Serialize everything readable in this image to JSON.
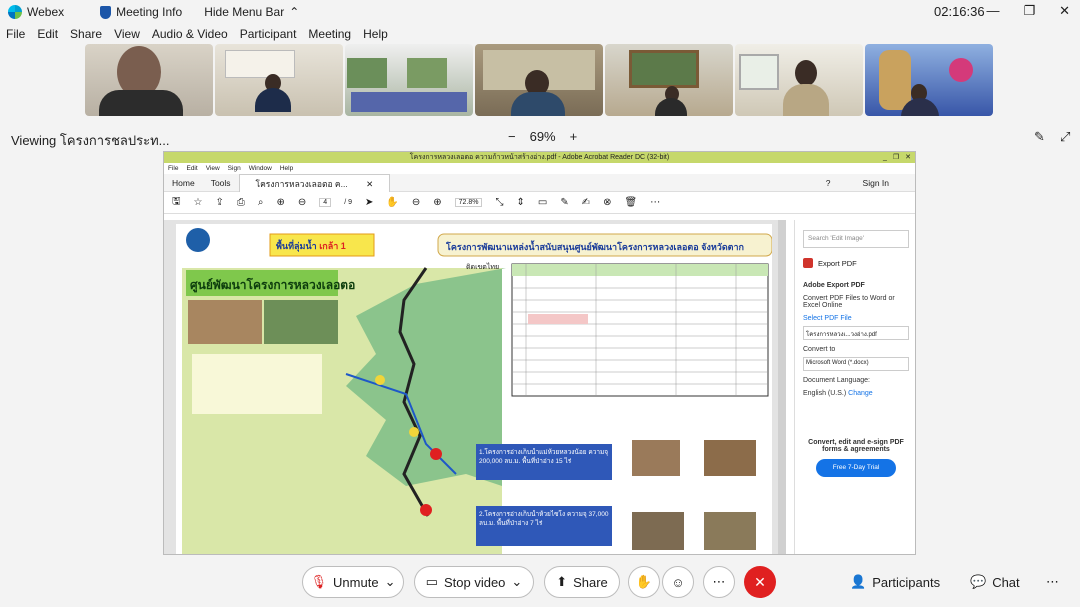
{
  "titlebar": {
    "app": "Webex",
    "meeting_info": "Meeting Info",
    "hide_menu": "Hide Menu Bar",
    "time": "02:16:36"
  },
  "menu": [
    "File",
    "Edit",
    "Share",
    "View",
    "Audio & Video",
    "Participant",
    "Meeting",
    "Help"
  ],
  "viewing": "Viewing โครงการชลประท...",
  "zoom": "69%",
  "acrobat": {
    "title": "โครงการหลวงเลอตอ ความก้าวหน้าสร้างอ่าง.pdf - Adobe Acrobat Reader DC (32-bit)",
    "menu": [
      "File",
      "Edit",
      "View",
      "Sign",
      "Window",
      "Help"
    ],
    "tabs": [
      "Home",
      "Tools",
      "โครงการหลวงเลอตอ ค..."
    ],
    "sign_in": "Sign In",
    "page": "4",
    "pages": "/ 9",
    "zoompct": "72.8%"
  },
  "doc": {
    "heading_left": "พื้นที่ลุ่มน้ำ",
    "heading_left2": "เกล้า 1",
    "heading_right": "โครงการพัฒนาแหล่งน้ำสนับสนุนศูนย์พัฒนาโครงการหลวงเลอตอ จังหวัดตาก",
    "center_name": "ศูนย์พัฒนาโครงการหลวงเลอตอ",
    "callouts": [
      "1.โครงการอ่างเก็บน้ำแม่ห้วยหลวงน้อย ความจุ 200,000 ลบ.ม. พื้นที่ป่าอ่าง 15 ไร่",
      "2.โครงการอ่างเก็บน้ำห้วยไซโง ความจุ 37,000 ลบ.ม. พื้นที่ป่าอ่าง 7 ไร่"
    ],
    "map_label": "ติดเขตไทย"
  },
  "panel": {
    "search": "Search 'Edit Image'",
    "export": "Export PDF",
    "adobe_export": "Adobe Export PDF",
    "export_desc": "Convert PDF Files to Word or Excel Online",
    "select": "Select PDF File",
    "file": "โครงการหลวงเ...วงอ่าง.pdf",
    "convert_to": "Convert to",
    "format": "Microsoft Word (*.docx)",
    "lang_label": "Document Language:",
    "lang": "English (U.S.)",
    "change": "Change",
    "promo": "Convert, edit and e-sign PDF forms & agreements",
    "trial": "Free 7-Day Trial"
  },
  "controls": {
    "unmute": "Unmute",
    "stop_video": "Stop video",
    "share": "Share",
    "participants": "Participants",
    "chat": "Chat"
  },
  "colors": {
    "accent": "#e02020",
    "acrobat_title": "#c6d86b",
    "link": "#1473e6"
  }
}
